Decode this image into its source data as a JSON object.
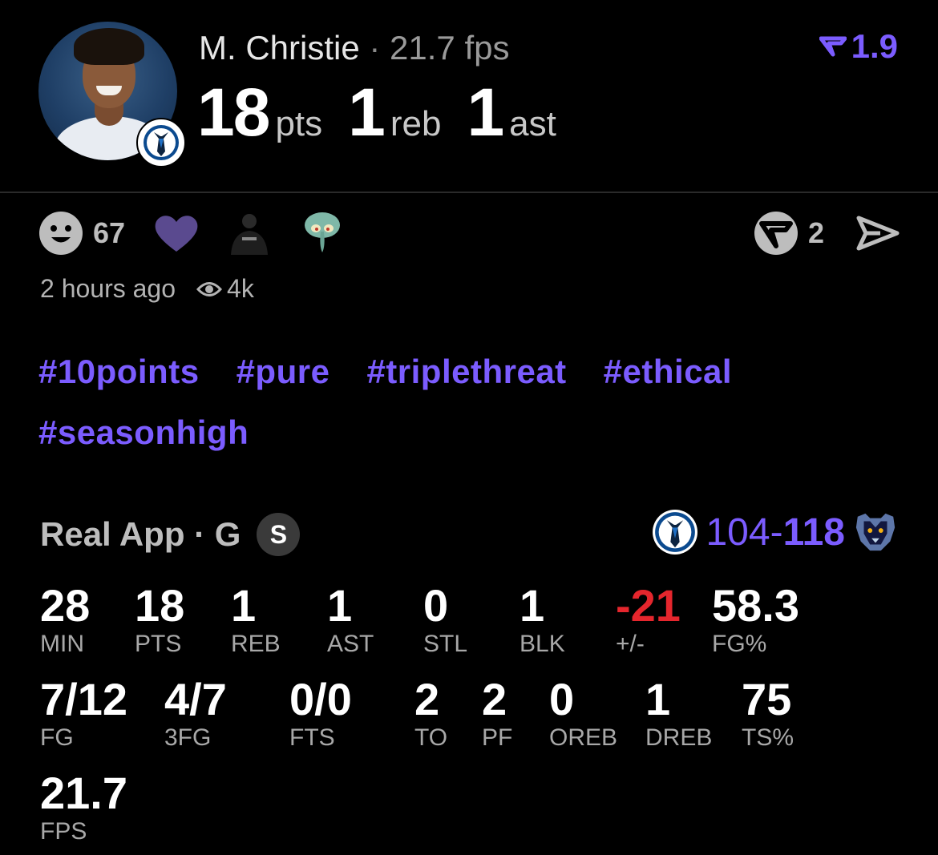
{
  "player": {
    "name": "M. Christie",
    "separator": "·",
    "fps_text": "21.7 fps",
    "rating": "1.9",
    "pts": "18",
    "pts_label": "pts",
    "reb": "1",
    "reb_label": "reb",
    "ast": "1",
    "ast_label": "ast"
  },
  "reactions": {
    "smile_count": "67",
    "real_count": "2",
    "time_ago": "2 hours ago",
    "views": "4k"
  },
  "tags": [
    "#10points",
    "#pure",
    "#triplethreat",
    "#ethical",
    "#seasonhigh"
  ],
  "game": {
    "label": "Real App · G",
    "badge": "S",
    "score_home": "104",
    "score_dash": "-",
    "score_away": "118"
  },
  "stats_row1": [
    {
      "value": "28",
      "label": "MIN"
    },
    {
      "value": "18",
      "label": "PTS"
    },
    {
      "value": "1",
      "label": "REB"
    },
    {
      "value": "1",
      "label": "AST"
    },
    {
      "value": "0",
      "label": "STL"
    },
    {
      "value": "1",
      "label": "BLK"
    },
    {
      "value": "-21",
      "label": "+/-"
    },
    {
      "value": "58.3",
      "label": "FG%"
    }
  ],
  "stats_row2": [
    {
      "value": "7/12",
      "label": "FG"
    },
    {
      "value": "4/7",
      "label": "3FG"
    },
    {
      "value": "0/0",
      "label": "FTS"
    },
    {
      "value": "2",
      "label": "TO"
    },
    {
      "value": "2",
      "label": "PF"
    },
    {
      "value": "0",
      "label": "OREB"
    },
    {
      "value": "1",
      "label": "DREB"
    },
    {
      "value": "75",
      "label": "TS%"
    }
  ],
  "stats_row3": [
    {
      "value": "21.7",
      "label": "FPS"
    }
  ],
  "colors": {
    "accent": "#7b5cff",
    "negative": "#e5262d",
    "background": "#000000"
  },
  "icons": {
    "smile": "smile-icon",
    "heart": "heart-icon",
    "view": "eye-icon",
    "share": "send-icon",
    "real": "real-logo-icon"
  }
}
